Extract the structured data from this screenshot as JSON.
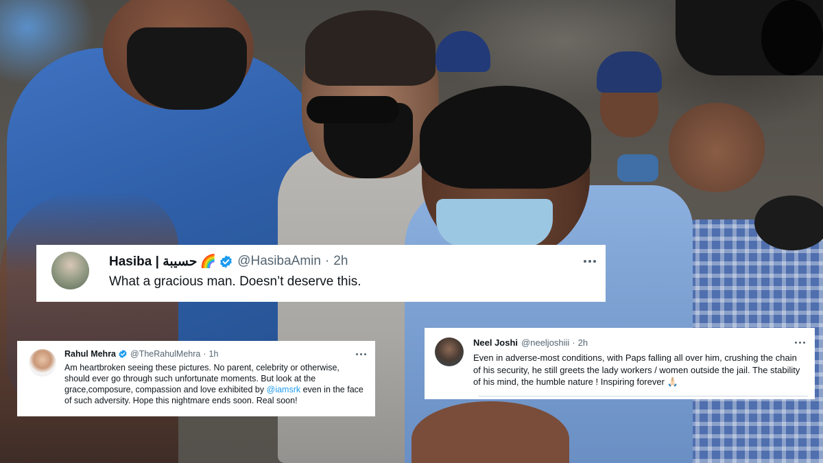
{
  "tweets": [
    {
      "display_name": "Hasiba | حسيبة",
      "emoji": "🌈",
      "handle": "@HasibaAmin",
      "separator": "·",
      "time": "2h",
      "text": "What a gracious man. Doesn’t deserve this."
    },
    {
      "display_name": "Rahul Mehra",
      "handle": "@TheRahulMehra",
      "separator": "·",
      "time": "1h",
      "text_before_mention": "Am heartbroken seeing these pictures. No parent, celebrity or otherwise, should ever go through such unfortunate moments. But look at the grace,composure, compassion and love exhibited by ",
      "mention": "@iamsrk",
      "text_after_mention": " even in the face of such adversity. Hope this nightmare ends soon. Real soon!"
    },
    {
      "display_name": "Neel Joshi",
      "handle": "@neeljoshiii",
      "separator": "·",
      "time": "2h",
      "text": "Even in adverse-most conditions, with Paps falling all over him, crushing the chain of his security, he still greets the lady workers / women outside the jail. The stability of his mind, the humble nature ! Inspiring forever 🙏🏻"
    }
  ],
  "colors": {
    "verified": "#1d9bf0",
    "mention": "#1d9bf0",
    "meta_text": "#536471",
    "card_bg": "#ffffff"
  },
  "icons": {
    "verified": "verified-badge-icon",
    "more": "more-options-icon"
  }
}
